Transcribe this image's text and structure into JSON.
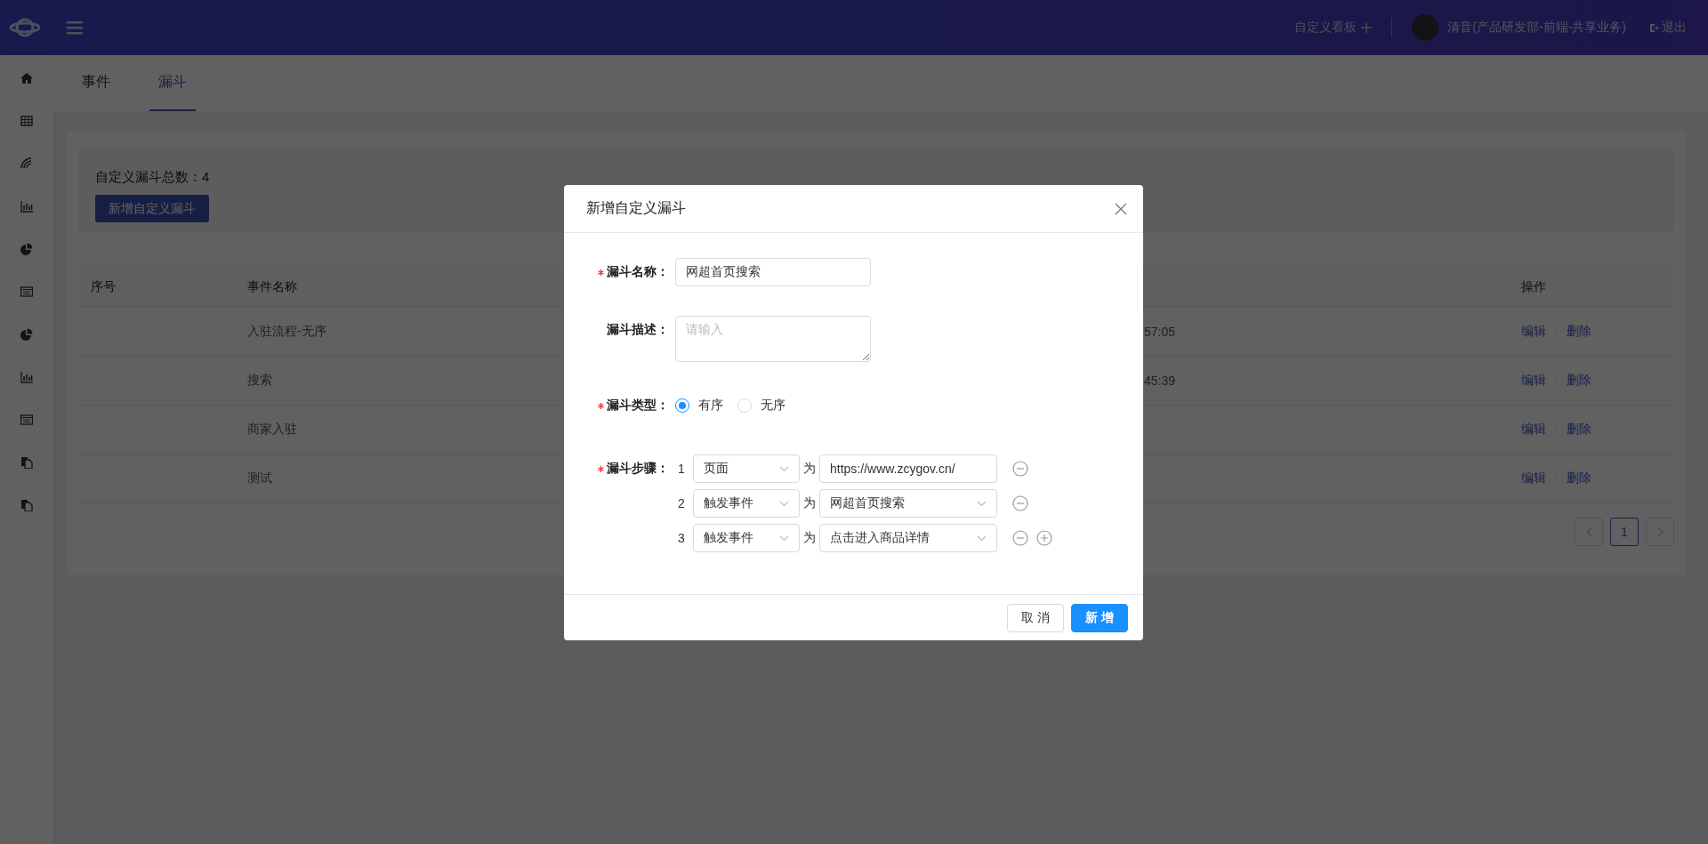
{
  "header": {
    "dashboard_link": "自定义看板",
    "user_name": "清音(产品研发部-前端-共享业务)",
    "logout": "退出"
  },
  "tabs": [
    {
      "label": "事件",
      "selected": false
    },
    {
      "label": "漏斗",
      "selected": true
    }
  ],
  "summary": {
    "count_text": "自定义漏斗总数：4",
    "add_button": "新增自定义漏斗"
  },
  "table": {
    "columns": [
      "序号",
      "事件名称",
      "操作"
    ],
    "rows": [
      {
        "event_name": "入驻流程-无序",
        "column_3": "57:05",
        "actions": [
          "编辑",
          "删除"
        ]
      },
      {
        "event_name": "搜索",
        "column_3": "45:39",
        "actions": [
          "编辑",
          "删除"
        ]
      },
      {
        "event_name": "商家入驻",
        "actions": [
          "编辑",
          "删除"
        ]
      },
      {
        "event_name": "测试",
        "actions": [
          "编辑",
          "删除"
        ]
      }
    ]
  },
  "pagination": {
    "pages": [
      {
        "label": "1",
        "selected": true
      }
    ]
  },
  "modal": {
    "title": "新增自定义漏斗",
    "name_field": {
      "label": "漏斗名称：",
      "required": true,
      "value": "网超首页搜索"
    },
    "description_field": {
      "label": "漏斗描述：",
      "required": false,
      "placeholder": "请输入"
    },
    "type_field": {
      "label": "漏斗类型：",
      "required": true,
      "options": [
        {
          "label": "有序",
          "selected": true
        },
        {
          "label": "无序",
          "selected": false
        }
      ]
    },
    "steps_field": {
      "label": "漏斗步骤：",
      "required": true,
      "steps": [
        {
          "index": "1",
          "type": "页面",
          "connector": "为",
          "value": "https://www.zcygov.cn/",
          "kind": "input",
          "can_add": false
        },
        {
          "index": "2",
          "type": "触发事件",
          "connector": "为",
          "value": "网超首页搜索",
          "kind": "select",
          "can_add": false
        },
        {
          "index": "3",
          "type": "触发事件",
          "connector": "为",
          "value": "点击进入商品详情",
          "kind": "select",
          "can_add": true
        }
      ]
    },
    "buttons": [
      {
        "label": "取 消",
        "kind": "default"
      },
      {
        "label": "新 增",
        "kind": "primary"
      }
    ]
  }
}
